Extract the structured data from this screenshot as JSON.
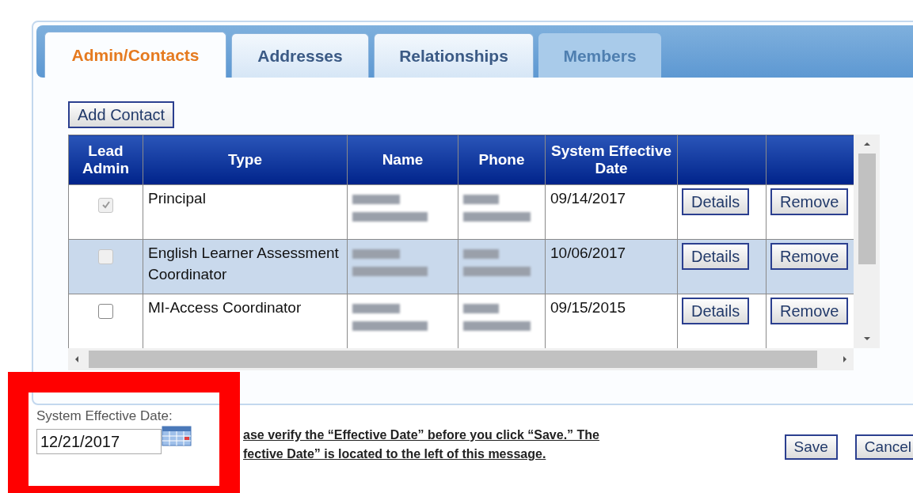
{
  "tabs": [
    {
      "label": "Admin/Contacts",
      "selected": true,
      "disabled": false
    },
    {
      "label": "Addresses",
      "selected": false,
      "disabled": false
    },
    {
      "label": "Relationships",
      "selected": false,
      "disabled": false
    },
    {
      "label": "Members",
      "selected": false,
      "disabled": true
    }
  ],
  "add_button": "Add Contact",
  "table": {
    "columns": [
      "Lead Admin",
      "Type",
      "Name",
      "Phone",
      "System Effective Date"
    ],
    "rows": [
      {
        "lead_admin": true,
        "lead_admin_disabled": true,
        "type": "Principal",
        "date": "09/14/2017",
        "selected": false,
        "actions": [
          "Details",
          "Remove"
        ]
      },
      {
        "lead_admin": false,
        "lead_admin_disabled": true,
        "type": "English Learner Assessment Coordinator",
        "date": "10/06/2017",
        "selected": true,
        "actions": [
          "Details",
          "Remove"
        ]
      },
      {
        "lead_admin": false,
        "lead_admin_disabled": false,
        "type": "MI-Access Coordinator",
        "date": "09/15/2015",
        "selected": false,
        "actions": [
          "Details",
          "Remove"
        ]
      }
    ]
  },
  "effective_date": {
    "label": "System Effective Date:",
    "value": "12/21/2017"
  },
  "message": [
    "ase verify the “Effective Date” before you click “Save.” The",
    "fective Date” is located to the left of this message."
  ],
  "buttons": [
    "Save",
    "Cancel"
  ]
}
